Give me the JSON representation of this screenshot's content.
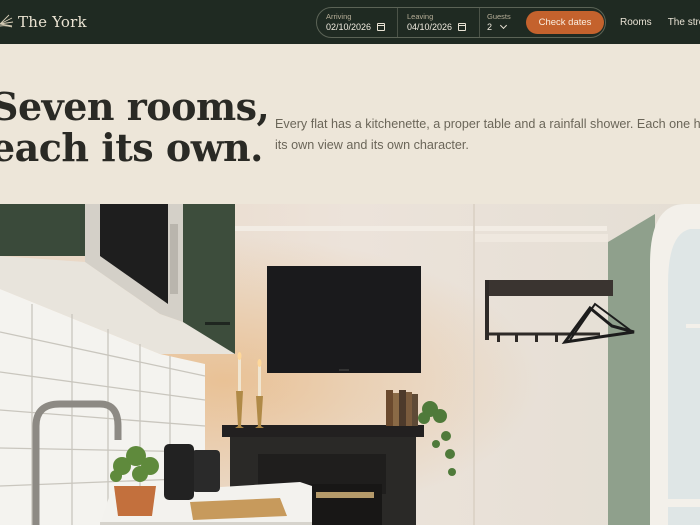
{
  "brand": {
    "name": "The York",
    "icon": "sunburst-logo-icon"
  },
  "booking": {
    "arriving_label": "Arriving",
    "arriving_value": "02/10/2026",
    "leaving_label": "Leaving",
    "leaving_value": "04/10/2026",
    "guests_label": "Guests",
    "guests_value": "2",
    "check_dates_label": "Check dates"
  },
  "nav": {
    "items": [
      "Rooms",
      "The stre"
    ]
  },
  "hero": {
    "title_line1": "Seven rooms,",
    "title_line2": "each its own.",
    "description": "Every flat has a kitchenette, a proper table and a rainfall shower. Each one has its own view and its own character."
  },
  "colors": {
    "header_bg": "#1f2a22",
    "page_bg": "#ede6d9",
    "accent": "#c4622d",
    "cabinet_green": "#3a4a3a"
  }
}
